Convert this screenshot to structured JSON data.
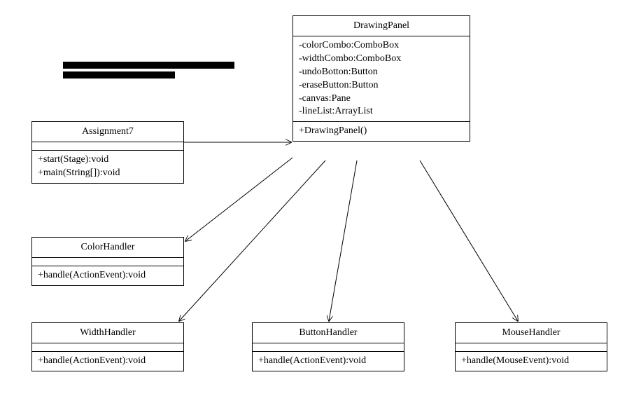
{
  "classes": {
    "drawingPanel": {
      "name": "DrawingPanel",
      "attributes": [
        "-colorCombo:ComboBox",
        "-widthCombo:ComboBox",
        "-undoBotton:Button",
        "-eraseButton:Button",
        "-canvas:Pane",
        "-lineList:ArrayList"
      ],
      "operations": [
        "+DrawingPanel()"
      ]
    },
    "assignment7": {
      "name": "Assignment7",
      "operations": [
        "+start(Stage):void",
        "+main(String[]):void"
      ]
    },
    "colorHandler": {
      "name": "ColorHandler",
      "operations": [
        "+handle(ActionEvent):void"
      ]
    },
    "widthHandler": {
      "name": "WidthHandler",
      "operations": [
        "+handle(ActionEvent):void"
      ]
    },
    "buttonHandler": {
      "name": "ButtonHandler",
      "operations": [
        "+handle(ActionEvent):void"
      ]
    },
    "mouseHandler": {
      "name": "MouseHandler",
      "operations": [
        "+handle(MouseEvent):void"
      ]
    }
  },
  "associations": [
    {
      "from": "assignment7",
      "to": "drawingPanel"
    },
    {
      "from": "drawingPanel",
      "to": "colorHandler"
    },
    {
      "from": "drawingPanel",
      "to": "widthHandler"
    },
    {
      "from": "drawingPanel",
      "to": "buttonHandler"
    },
    {
      "from": "drawingPanel",
      "to": "mouseHandler"
    }
  ]
}
